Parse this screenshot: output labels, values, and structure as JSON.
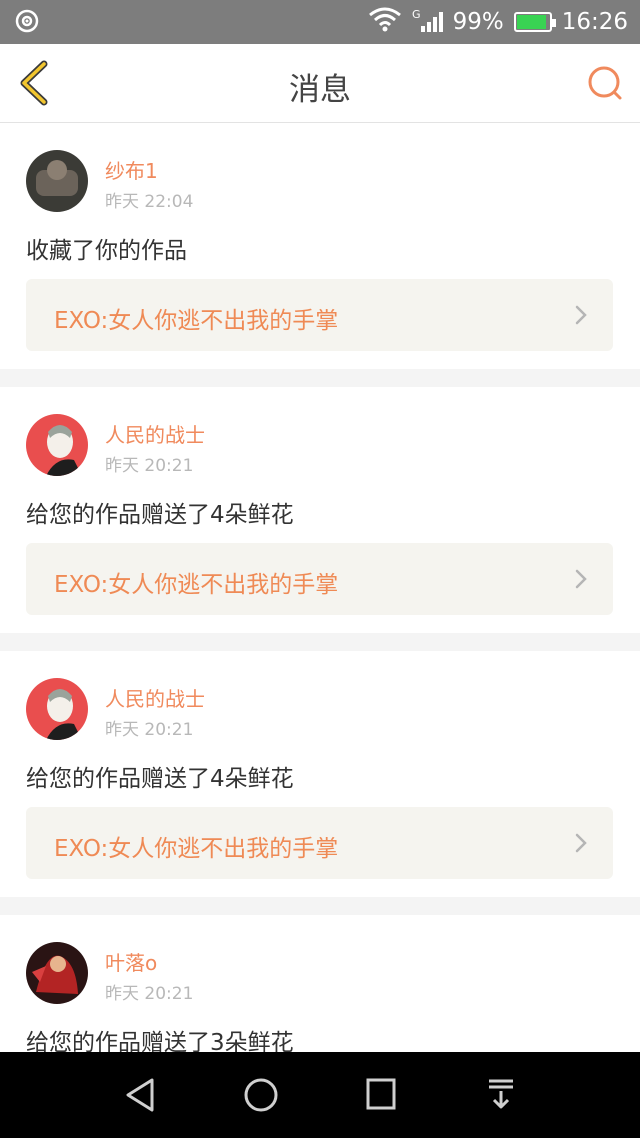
{
  "status_bar": {
    "network_type": "G",
    "battery_percent": "99%",
    "time": "16:26"
  },
  "nav": {
    "title": "消息"
  },
  "messages": [
    {
      "user": "纱布1",
      "time": "昨天 22:04",
      "action": "收藏了你的作品",
      "work_title": "EXO:女人你逃不出我的手掌"
    },
    {
      "user": "人民的战士",
      "time": "昨天 20:21",
      "action": "给您的作品赠送了4朵鲜花",
      "work_title": "EXO:女人你逃不出我的手掌"
    },
    {
      "user": "人民的战士",
      "time": "昨天 20:21",
      "action": "给您的作品赠送了4朵鲜花",
      "work_title": "EXO:女人你逃不出我的手掌"
    },
    {
      "user": "叶落o",
      "time": "昨天 20:21",
      "action": "给您的作品赠送了3朵鲜花",
      "work_title": ""
    }
  ],
  "colors": {
    "accent": "#f08a5d",
    "back_arrow": "#f2c62f",
    "card_bg": "#f5f4ef"
  }
}
